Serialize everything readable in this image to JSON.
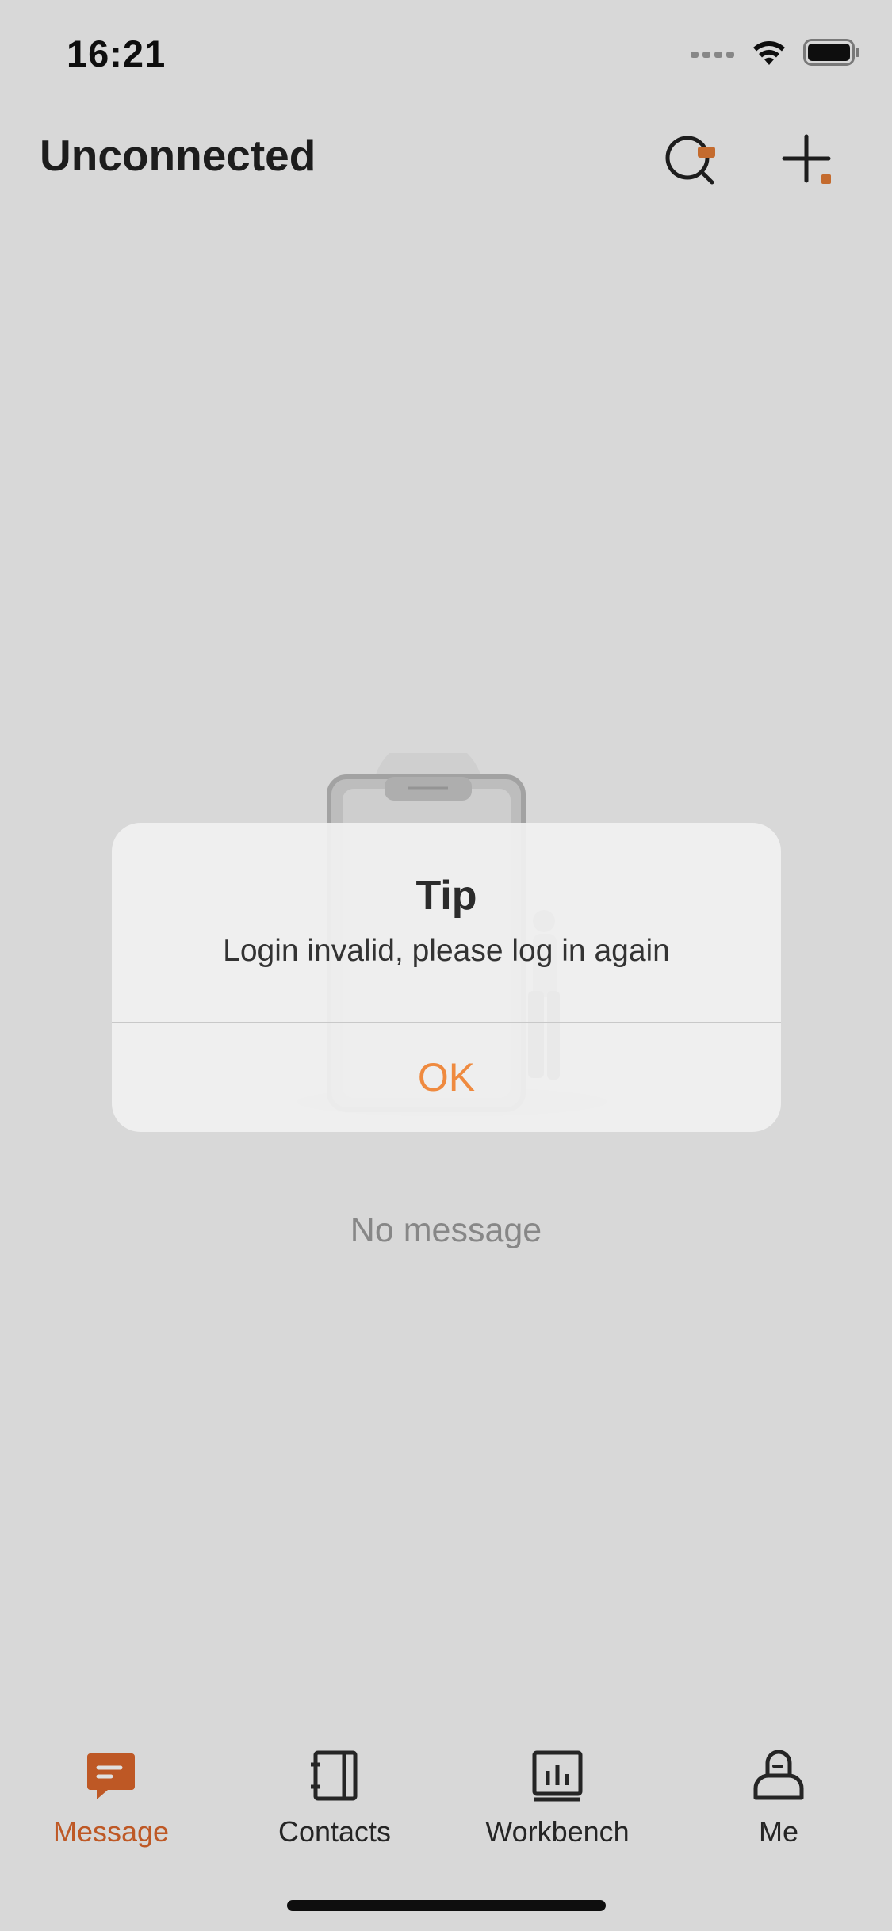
{
  "status_bar": {
    "time": "16:21",
    "icons": [
      "signal-icon",
      "wifi-icon",
      "battery-icon"
    ]
  },
  "header": {
    "title": "Unconnected",
    "search_icon": "search-icon",
    "add_icon": "add-icon"
  },
  "empty_state": {
    "text": "No message",
    "illustration_icon": "phone-person-illustration"
  },
  "tabs": [
    {
      "label": "Message",
      "icon": "message-icon",
      "active": true
    },
    {
      "label": "Contacts",
      "icon": "contacts-icon",
      "active": false
    },
    {
      "label": "Workbench",
      "icon": "workbench-icon",
      "active": false
    },
    {
      "label": "Me",
      "icon": "me-icon",
      "active": false
    }
  ],
  "alert": {
    "title": "Tip",
    "message": "Login invalid, please log in again",
    "ok_label": "OK"
  },
  "colors": {
    "accent": "#d9652b",
    "ok_button": "#ef8a3f",
    "background": "#f6f6f6"
  }
}
